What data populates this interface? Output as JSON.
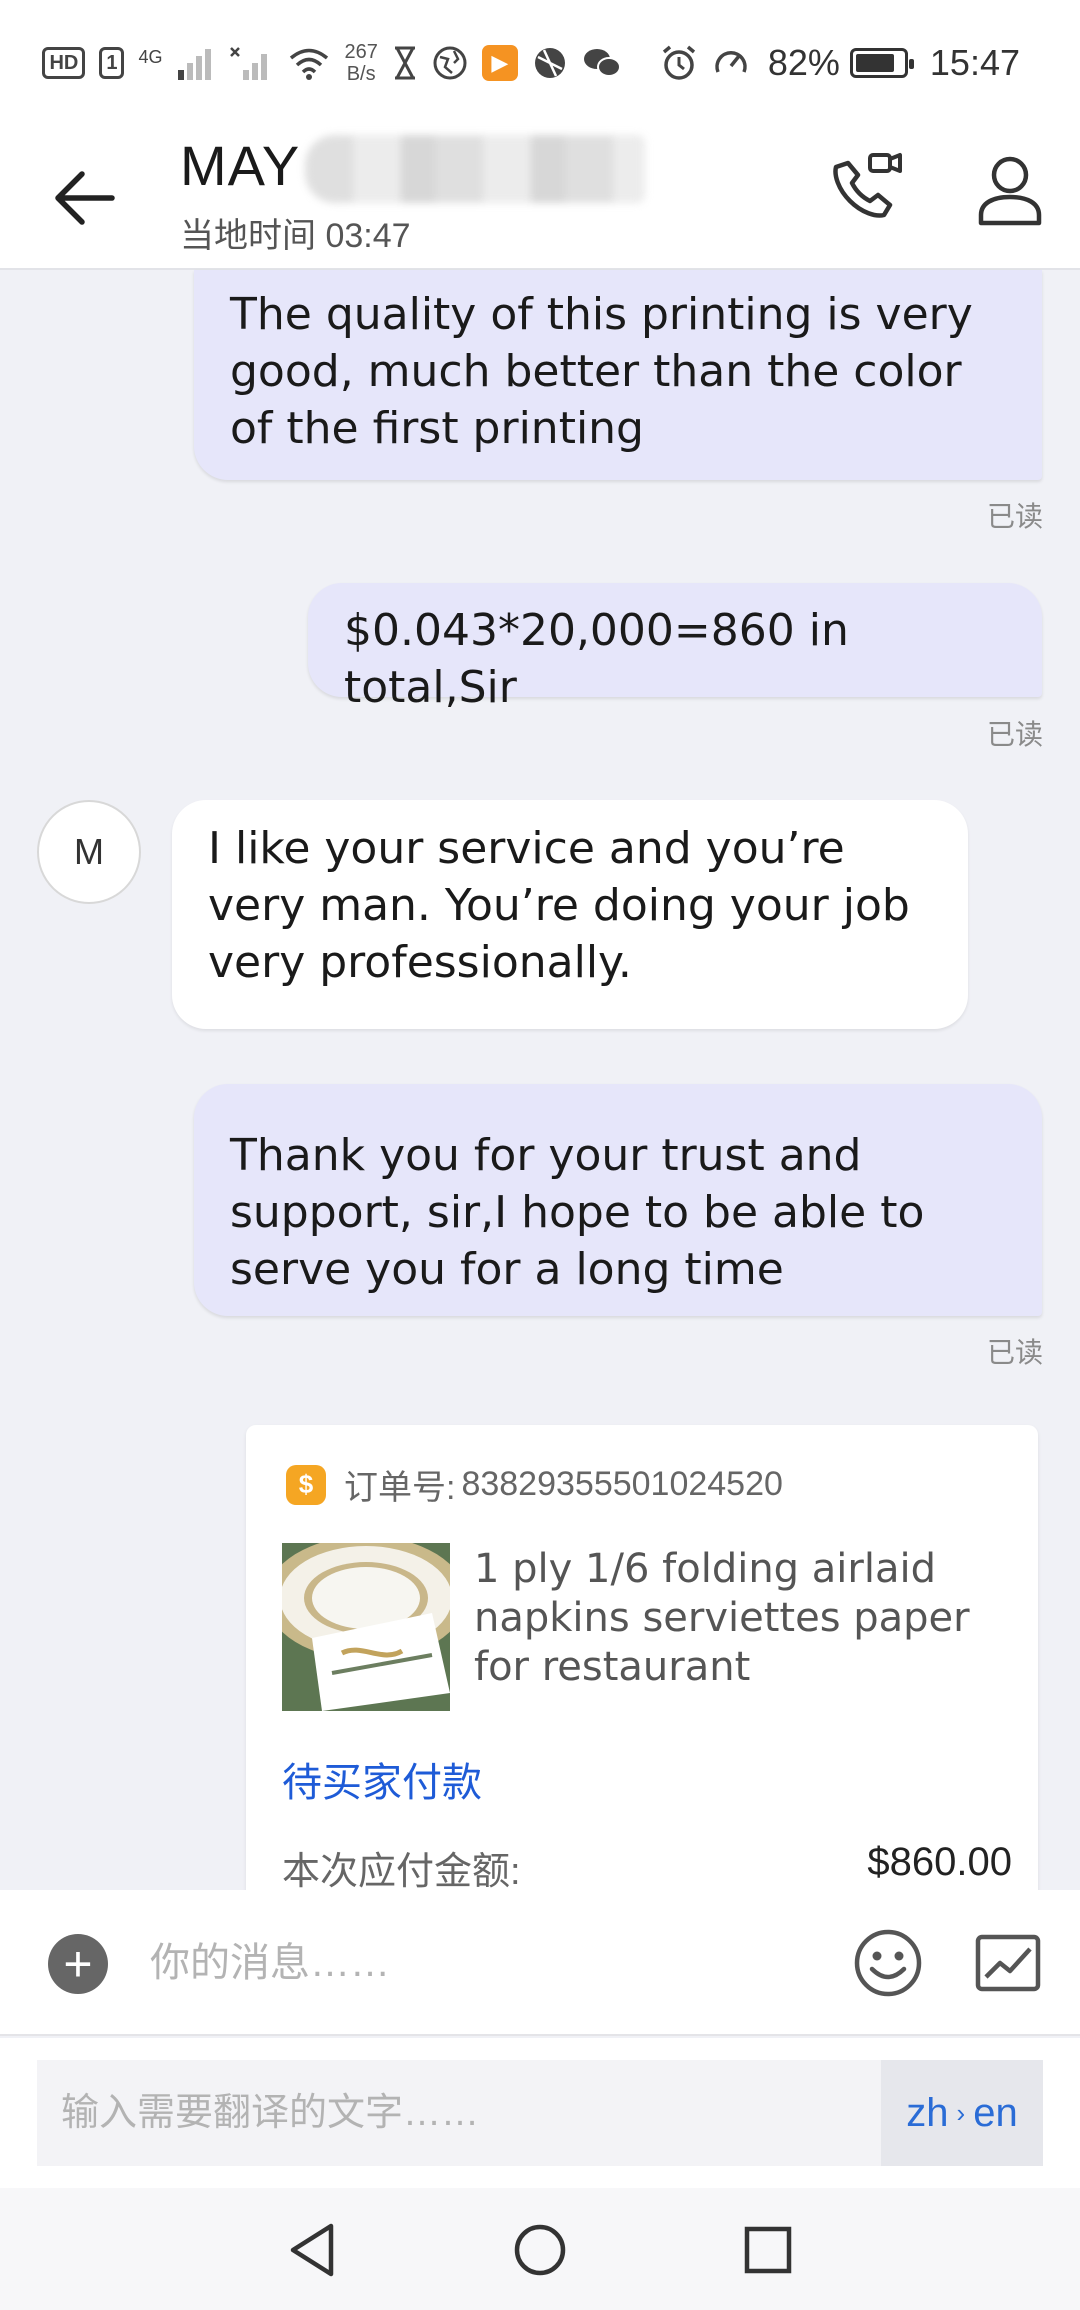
{
  "status_bar": {
    "hd_badge": "HD",
    "sim_slot": "1",
    "network_type": "4G",
    "net_rate_value": "267",
    "net_rate_unit": "B/s",
    "battery_percent": "82%",
    "battery_level": 0.82,
    "time": "15:47"
  },
  "header": {
    "contact_name": "MAY",
    "local_time": "当地时间 03:47"
  },
  "messages": [
    {
      "direction": "outgoing",
      "text": "The quality of this printing is very good, much better than the color of the first printing",
      "status": "已读"
    },
    {
      "direction": "outgoing",
      "text": "$0.043*20,000=860 in total,Sir",
      "status": "已读"
    },
    {
      "direction": "incoming",
      "avatar_letter": "M",
      "text": "I like your service and you’re very man. You’re doing your job very professionally."
    },
    {
      "direction": "outgoing",
      "text": "Thank you for your trust and support, sir,I hope to be able to serve you for a long time",
      "status": "已读"
    }
  ],
  "order_card": {
    "order_label": "订单号:",
    "order_number": "83829355501024520",
    "product_title": "1 ply 1/6 folding airlaid napkins serviettes paper for restaurant",
    "status": "待买家付款",
    "amount_label": "本次应付金额:",
    "amount": "$860.00"
  },
  "composer": {
    "placeholder": "你的消息……"
  },
  "translator": {
    "placeholder": "输入需要翻译的文字……",
    "source_lang": "zh",
    "target_lang": "en"
  },
  "colors": {
    "outgoing_bubble": "#e6e6fa",
    "incoming_bubble": "#ffffff",
    "chat_background": "#f0f1f6",
    "link_blue": "#1e5bd7",
    "order_icon": "#f5a623"
  },
  "icons": [
    "back-arrow-icon",
    "video-call-icon",
    "profile-icon",
    "plus-icon",
    "emoji-icon",
    "image-icon",
    "nav-back-icon",
    "nav-home-icon",
    "nav-recent-icon"
  ]
}
